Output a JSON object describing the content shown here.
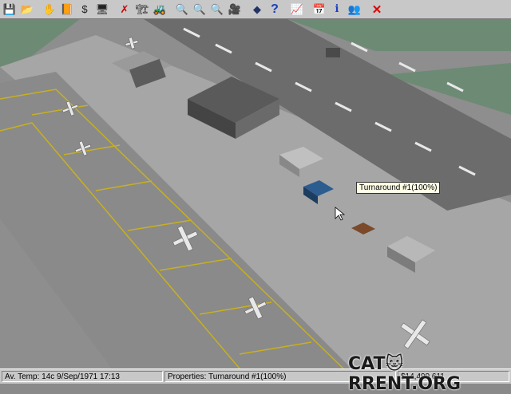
{
  "toolbar": {
    "buttons": [
      {
        "name": "save-icon",
        "glyph": "💾"
      },
      {
        "name": "load-icon",
        "glyph": "📂"
      },
      {
        "name": "hand-icon",
        "glyph": "✋"
      },
      {
        "name": "notebook-icon",
        "glyph": "📙"
      },
      {
        "name": "finance-icon",
        "glyph": "$"
      },
      {
        "name": "monitor-icon",
        "glyph": "🖥"
      },
      {
        "name": "demolish-icon",
        "glyph": "✗"
      },
      {
        "name": "construct-icon",
        "glyph": "🏗"
      },
      {
        "name": "bulldozer-icon",
        "glyph": "🚜"
      },
      {
        "name": "zoom-out-icon",
        "glyph": "🔍"
      },
      {
        "name": "zoom-in-icon",
        "glyph": "🔍"
      },
      {
        "name": "zoom-reset-icon",
        "glyph": "🔍"
      },
      {
        "name": "camera-icon",
        "glyph": "🎥"
      },
      {
        "name": "layers-icon",
        "glyph": "◆"
      },
      {
        "name": "help-icon",
        "glyph": "?"
      },
      {
        "name": "graph-icon",
        "glyph": "📈"
      },
      {
        "name": "calendar-icon",
        "glyph": "📅"
      },
      {
        "name": "info-icon",
        "glyph": "i"
      },
      {
        "name": "people-icon",
        "glyph": "👥"
      },
      {
        "name": "close-icon",
        "glyph": "✕"
      }
    ]
  },
  "tooltip": "Turnaround #1(100%)",
  "status": {
    "temp_date": "Av. Temp: 14c  9/Sep/1971 17:13",
    "properties": "Properties: Turnaround #1(100%)",
    "money": "$14,499,611"
  },
  "watermark": "CAT🐱RRENT.ORG",
  "colors": {
    "ground": "#8a8a8a",
    "apron": "#a3a3a3",
    "runway": "#6e6e6e",
    "grass": "#6f8f78",
    "taxi_line": "#c8b020"
  }
}
